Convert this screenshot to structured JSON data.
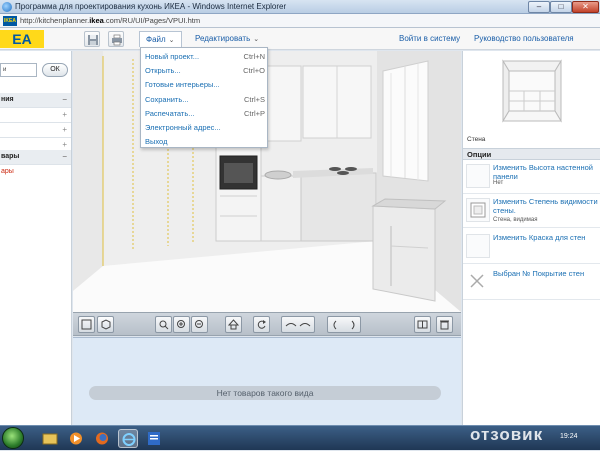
{
  "window": {
    "title": "Программа для проектирования кухонь ИКЕА - Windows Internet Explorer",
    "url_prefix": "http://kitchenplanner.",
    "url_domain": "ikea",
    "url_suffix": ".com/RU/UI/Pages/VPUI.htm",
    "controls": {
      "minimize": "–",
      "maximize": "□",
      "close": "✕"
    }
  },
  "header": {
    "logo_text": "EA",
    "menu_file": "Файл",
    "menu_edit": "Редактировать",
    "login_link": "Войти в систему",
    "guide_link": "Руководство пользователя"
  },
  "file_menu": [
    {
      "label": "Новый проект...",
      "shortcut": "Ctrl+N"
    },
    {
      "label": "Открыть...",
      "shortcut": "Ctrl+O"
    },
    {
      "label": "Готовые интерьеры...",
      "shortcut": ""
    },
    {
      "label": "Сохранить...",
      "shortcut": "Ctrl+S"
    },
    {
      "label": "Распечатать...",
      "shortcut": "Ctrl+P"
    },
    {
      "label": "Электронный адрес...",
      "shortcut": ""
    },
    {
      "label": "Выход",
      "shortcut": ""
    }
  ],
  "left_panel": {
    "search_value": "и",
    "ok_label": "ОК",
    "rows": [
      {
        "label": "ния",
        "header": true
      },
      {
        "label": "",
        "header": false
      },
      {
        "label": "",
        "header": false
      },
      {
        "label": "",
        "header": false
      },
      {
        "label": "вары",
        "header": true
      },
      {
        "label": "ары",
        "header": false
      }
    ]
  },
  "products_area": {
    "empty_message": "Нет товаров такого вида"
  },
  "right_panel": {
    "preview_label": "Стена",
    "options_heading": "Опции",
    "options": [
      {
        "title": "Изменить Высота настенной панели",
        "sub": "Нет"
      },
      {
        "title": "Изменить Степень видимости стены.",
        "sub": "Стена, видимая"
      },
      {
        "title": "Изменить Краска для стен",
        "sub": ""
      },
      {
        "title": "Выбран № Покрытие стен",
        "sub": ""
      }
    ]
  },
  "taskbar": {
    "clock": "19:24",
    "watermark": "отзовик"
  },
  "colors": {
    "ikea_blue": "#0058a3",
    "ikea_yellow": "#ffd91a",
    "link_blue": "#1a6fb3",
    "product_area_bg": "#dde9f6"
  }
}
